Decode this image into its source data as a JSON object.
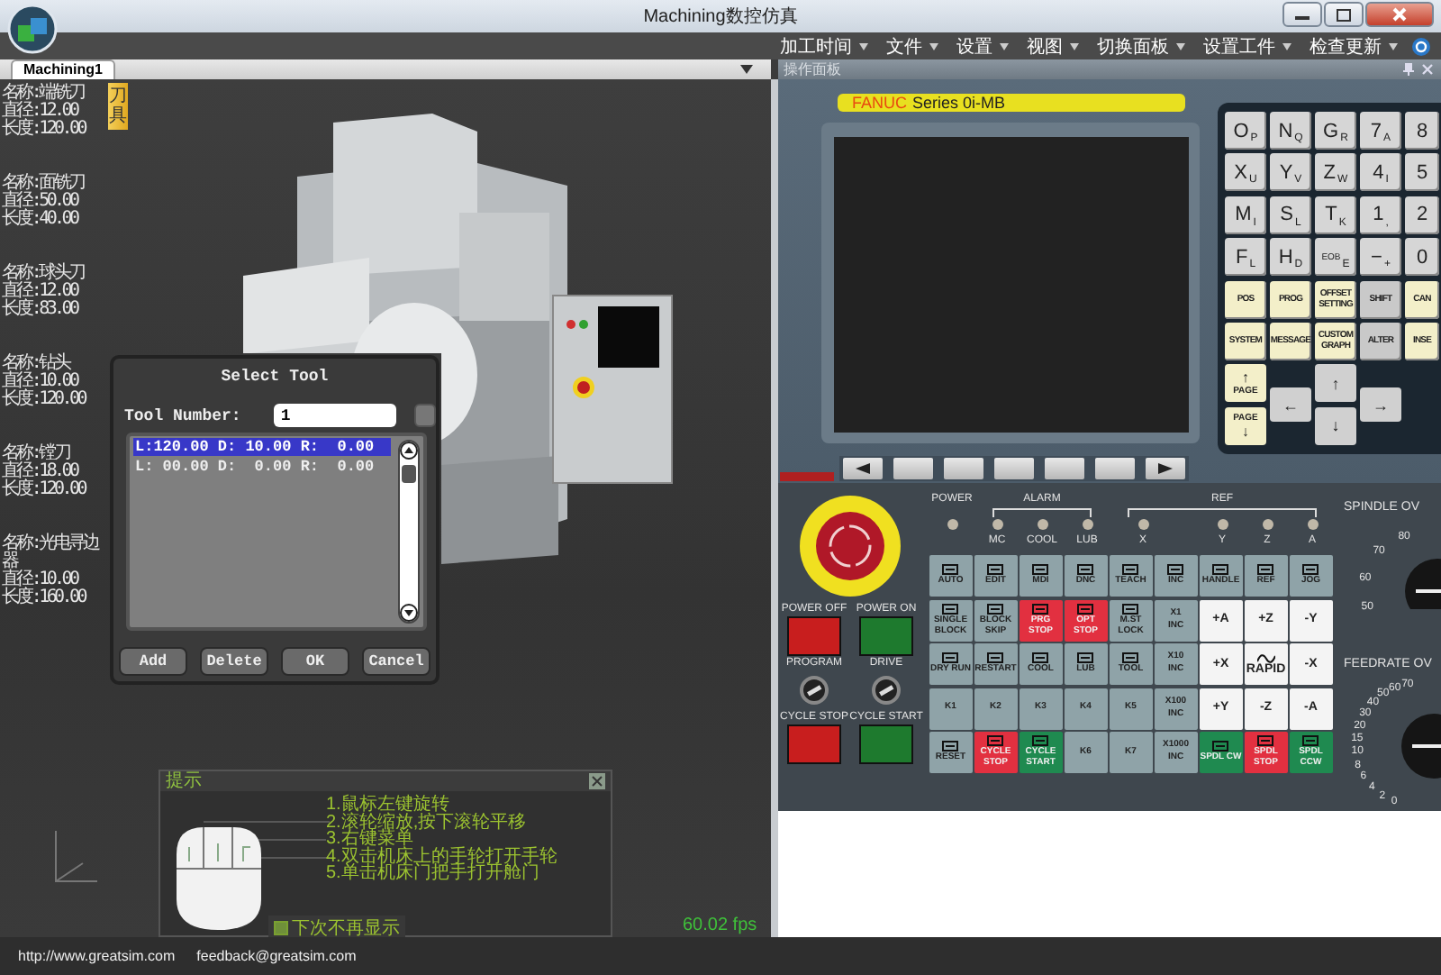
{
  "window": {
    "title": "Machining数控仿真"
  },
  "menu": [
    "加工时间",
    "文件",
    "设置",
    "视图",
    "切换面板",
    "设置工件",
    "检查更新"
  ],
  "tabs": [
    {
      "label": "Machining1",
      "selected": true
    }
  ],
  "panel_title": "操作面板",
  "tool_list": {
    "side_tab": "刀具",
    "tools": [
      {
        "name": "名称:端铣刀",
        "diameter": "直径:12.00",
        "length": "长度:120.00"
      },
      {
        "name": "名称:面铣刀",
        "diameter": "直径:50.00",
        "length": "长度:40.00"
      },
      {
        "name": "名称:球头刀",
        "diameter": "直径:12.00",
        "length": "长度:83.00"
      },
      {
        "name": "名称:钻头",
        "diameter": "直径:10.00",
        "length": "长度:120.00"
      },
      {
        "name": "名称:镗刀",
        "diameter": "直径:18.00",
        "length": "长度:120.00"
      },
      {
        "name": "名称:光电寻边器",
        "diameter": "直径:10.00",
        "length": "长度:160.00"
      }
    ]
  },
  "select_tool_dialog": {
    "title": "Select Tool",
    "label": "Tool Number:",
    "value": "1",
    "rows": [
      {
        "text": "L:120.00 D: 10.00 R:  0.00",
        "selected": true
      },
      {
        "text": "L: 00.00 D:  0.00 R:  0.00",
        "selected": false
      }
    ],
    "buttons": [
      "Add",
      "Delete",
      "OK",
      "Cancel"
    ]
  },
  "hint": {
    "title": "提示",
    "lines": [
      "1.鼠标左键旋转",
      "2.滚轮缩放,按下滚轮平移",
      "3.右键菜单",
      "4.双击机床上的手轮打开手轮",
      "5.单击机床门把手打开舱门"
    ],
    "checkbox": {
      "label": "下次不再显示",
      "checked": false
    }
  },
  "fps": "60.02 fps",
  "cnc": {
    "brand": "FANUC",
    "model": "Series 0i-MB",
    "keys": [
      {
        "main": "O",
        "sub": "P",
        "kind": "char"
      },
      {
        "main": "N",
        "sub": "Q",
        "kind": "char"
      },
      {
        "main": "G",
        "sub": "R",
        "kind": "char"
      },
      {
        "main": "7",
        "sub": "A",
        "kind": "char"
      },
      {
        "main": "8",
        "kind": "char"
      },
      {
        "main": "X",
        "sub": "U",
        "kind": "char"
      },
      {
        "main": "Y",
        "sub": "V",
        "kind": "char"
      },
      {
        "main": "Z",
        "sub": "W",
        "kind": "char"
      },
      {
        "main": "4",
        "sub": "I",
        "kind": "char"
      },
      {
        "main": "5",
        "kind": "char"
      },
      {
        "main": "M",
        "sub": "I",
        "kind": "char"
      },
      {
        "main": "S",
        "sub": "L",
        "kind": "char"
      },
      {
        "main": "T",
        "sub": "K",
        "kind": "char"
      },
      {
        "main": "1",
        "sub": ",",
        "kind": "char"
      },
      {
        "main": "2",
        "kind": "char"
      },
      {
        "main": "F",
        "sub": "L",
        "kind": "char"
      },
      {
        "main": "H",
        "sub": "D",
        "kind": "char"
      },
      {
        "main": "EOB",
        "sub": "E",
        "kind": "char"
      },
      {
        "main": "−",
        "sub": "+",
        "kind": "char"
      },
      {
        "main": "0",
        "kind": "char"
      },
      {
        "main": "POS",
        "kind": "func"
      },
      {
        "main": "PROG",
        "kind": "func"
      },
      {
        "main": "OFFSET SETTING",
        "kind": "func"
      },
      {
        "main": "SHIFT",
        "kind": "edit"
      },
      {
        "main": "CAN",
        "kind": "func"
      },
      {
        "main": "SYSTEM",
        "kind": "func"
      },
      {
        "main": "MESSAGE",
        "kind": "func"
      },
      {
        "main": "CUSTOM GRAPH",
        "kind": "func"
      },
      {
        "main": "ALTER",
        "kind": "edit"
      },
      {
        "main": "INSE",
        "kind": "func"
      }
    ],
    "nav_keys": [
      {
        "label": "PAGE",
        "arrow": "↑",
        "kind": "page"
      },
      {
        "arrow": "↑",
        "kind": "arrow"
      },
      {
        "arrow": "←",
        "kind": "arrow"
      },
      {
        "arrow": "→",
        "kind": "arrow"
      },
      {
        "label": "PAGE",
        "arrow": "↓",
        "kind": "page"
      },
      {
        "arrow": "↓",
        "kind": "arrow"
      }
    ],
    "soft_keys": [
      {
        "kind": "prev"
      },
      {
        "kind": "blank"
      },
      {
        "kind": "blank"
      },
      {
        "kind": "blank"
      },
      {
        "kind": "blank"
      },
      {
        "kind": "blank"
      },
      {
        "kind": "next"
      }
    ]
  },
  "machine_panel": {
    "power": "POWER",
    "alarm": {
      "label": "ALARM",
      "lamps": [
        "MC",
        "COOL",
        "LUB"
      ]
    },
    "ref": {
      "label": "REF",
      "lamps": [
        "X",
        "Y",
        "Z",
        "A"
      ]
    },
    "switches": [
      {
        "label": "POWER OFF",
        "kind": "red"
      },
      {
        "label": "POWER ON",
        "kind": "green"
      },
      {
        "label": "CYCLE STOP",
        "kind": "red"
      },
      {
        "label": "CYCLE START",
        "kind": "green"
      }
    ],
    "key_switches": [
      {
        "label": "PROGRAM",
        "on": true
      },
      {
        "label": "DRIVE",
        "on": true
      }
    ],
    "keys": [
      {
        "label": "AUTO",
        "kind": "mode"
      },
      {
        "label": "EDIT",
        "kind": "mode"
      },
      {
        "label": "MDI",
        "kind": "mode"
      },
      {
        "label": "DNC",
        "kind": "mode"
      },
      {
        "label": "TEACH",
        "kind": "mode"
      },
      {
        "label": "INC",
        "kind": "mode"
      },
      {
        "label": "HANDLE",
        "kind": "mode"
      },
      {
        "label": "REF",
        "kind": "mode"
      },
      {
        "label": "JOG",
        "kind": "mode"
      },
      {
        "label": "SINGLE BLOCK",
        "kind": "mode"
      },
      {
        "label": "BLOCK SKIP",
        "kind": "mode"
      },
      {
        "label": "PRG STOP",
        "kind": "red"
      },
      {
        "label": "OPT STOP",
        "kind": "red"
      },
      {
        "label": "M.ST LOCK",
        "kind": "mode"
      },
      {
        "label": "X1",
        "sub": "INC",
        "kind": "plain"
      },
      {
        "label": "+A",
        "kind": "axis"
      },
      {
        "label": "+Z",
        "kind": "axis"
      },
      {
        "label": "-Y",
        "kind": "axis"
      },
      {
        "label": "DRY RUN",
        "kind": "mode"
      },
      {
        "label": "RESTART",
        "kind": "mode"
      },
      {
        "label": "COOL",
        "kind": "mode"
      },
      {
        "label": "LUB",
        "kind": "mode"
      },
      {
        "label": "TOOL",
        "kind": "mode"
      },
      {
        "label": "X10",
        "sub": "INC",
        "kind": "plain"
      },
      {
        "label": "+X",
        "kind": "axis"
      },
      {
        "label": "RAPID",
        "kind": "axis_icon"
      },
      {
        "label": "-X",
        "kind": "axis"
      },
      {
        "label": "K1",
        "kind": "plain"
      },
      {
        "label": "K2",
        "kind": "plain"
      },
      {
        "label": "K3",
        "kind": "plain"
      },
      {
        "label": "K4",
        "kind": "plain"
      },
      {
        "label": "K5",
        "kind": "plain"
      },
      {
        "label": "X100",
        "sub": "INC",
        "kind": "plain"
      },
      {
        "label": "+Y",
        "kind": "axis"
      },
      {
        "label": "-Z",
        "kind": "axis"
      },
      {
        "label": "-A",
        "kind": "axis"
      },
      {
        "label": "RESET",
        "kind": "mode"
      },
      {
        "label": "CYCLE STOP",
        "kind": "red"
      },
      {
        "label": "CYCLE START",
        "kind": "green"
      },
      {
        "label": "K6",
        "kind": "plain"
      },
      {
        "label": "K7",
        "kind": "plain"
      },
      {
        "label": "X1000",
        "sub": "INC",
        "kind": "plain"
      },
      {
        "label": "SPDL CW",
        "kind": "green"
      },
      {
        "label": "SPDL STOP",
        "kind": "red"
      },
      {
        "label": "SPDL CCW",
        "kind": "green"
      }
    ],
    "dials": [
      {
        "label": "SPINDLE OV",
        "ticks": [
          "80",
          "70",
          "60",
          "50"
        ]
      },
      {
        "label": "FEEDRATE OV",
        "ticks": [
          "70",
          "60",
          "50",
          "40",
          "30",
          "20",
          "15",
          "10",
          "8",
          "6",
          "4",
          "2",
          "0"
        ]
      }
    ]
  },
  "status": [
    "http://www.greatsim.com",
    "feedback@greatsim.com"
  ]
}
